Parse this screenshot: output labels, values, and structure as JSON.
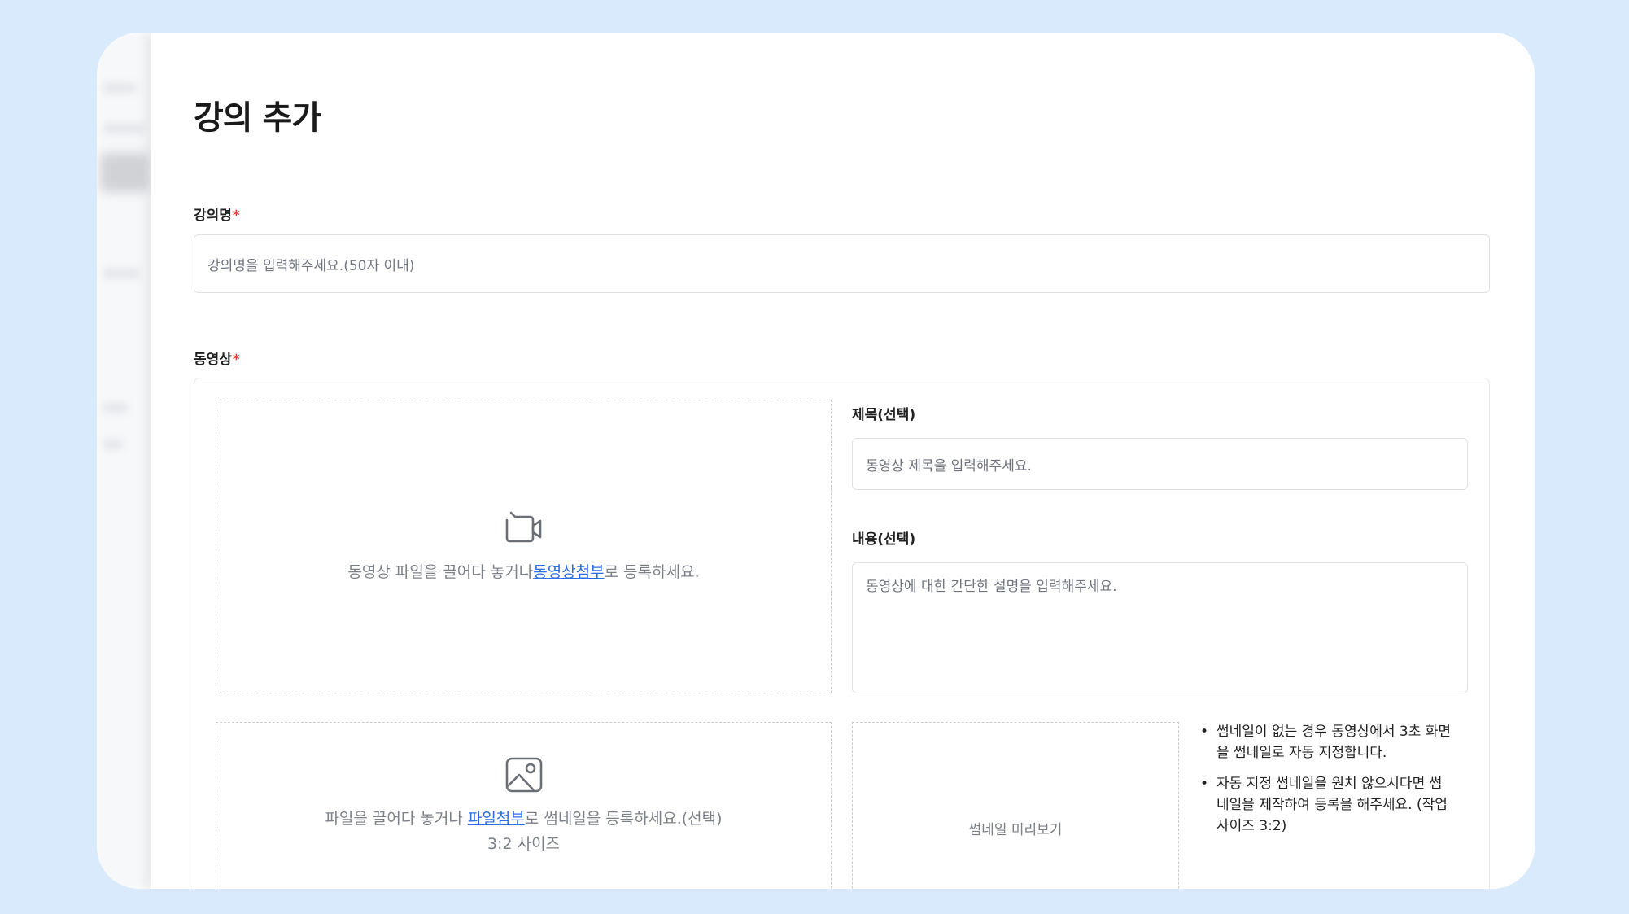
{
  "page": {
    "title": "강의 추가"
  },
  "lecture_name": {
    "label": "강의명",
    "required_mark": "*",
    "placeholder": "강의명을 입력해주세요.(50자 이내)"
  },
  "video": {
    "label": "동영상",
    "required_mark": "*",
    "upload": {
      "icon": "video-camera-icon",
      "text_before": "동영상 파일을 끌어다 놓거나",
      "link": "동영상첨부",
      "text_after": "로 등록하세요."
    },
    "title_field": {
      "label": "제목(선택)",
      "placeholder": "동영상 제목을 입력해주세요."
    },
    "content_field": {
      "label": "내용(선택)",
      "placeholder": "동영상에 대한 간단한 설명을 입력해주세요."
    },
    "thumbnail_upload": {
      "icon": "image-icon",
      "text_before": "파일을 끌어다 놓거나 ",
      "link": "파일첨부",
      "text_after": "로 썸네일을 등록하세요.(선택)",
      "size_hint": "3:2 사이즈"
    },
    "thumbnail_preview": "썸네일 미리보기",
    "notes": [
      "썸네일이 없는 경우 동영상에서 3초 화면을 썸네일로 자동 지정합니다.",
      "자동 지정 썸네일을 원치 않으시다면 썸네일을 제작하여 등록을 해주세요. (작업 사이즈 3:2)"
    ]
  },
  "colors": {
    "background": "#d9eafc",
    "link": "#2b6de6",
    "required": "#e5393a",
    "placeholder": "#707580"
  }
}
